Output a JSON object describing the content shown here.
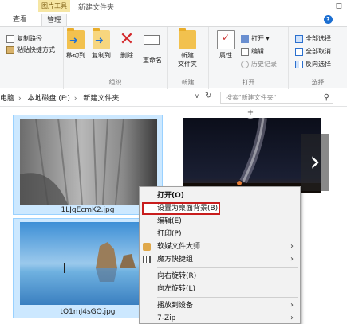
{
  "window": {
    "title": "新建文件夹",
    "context_group": "图片工具"
  },
  "tabs": {
    "view": "查看",
    "manage": "管理"
  },
  "ribbon": {
    "clipboard": {
      "copy_path": "复制路径",
      "paste_shortcut": "粘贴快捷方式"
    },
    "organize": {
      "move_to": "移动到",
      "copy_to": "复制到",
      "delete": "删除",
      "rename": "重命名",
      "label": "组织"
    },
    "new": {
      "new_folder_line1": "新建",
      "new_folder_line2": "文件夹",
      "label": "新建"
    },
    "open": {
      "properties": "属性",
      "open": "打开",
      "edit": "编辑",
      "history": "历史记录",
      "label": "打开"
    },
    "select": {
      "select_all": "全部选择",
      "select_none": "全部取消",
      "invert": "反向选择",
      "label": "选择"
    }
  },
  "address": {
    "crumbs": [
      "电脑",
      "本地磁盘 (F:)",
      "新建文件夹"
    ],
    "search_placeholder": "搜索\"新建文件夹\""
  },
  "files": [
    {
      "name": "1LJqEcmK2.jpg"
    },
    {
      "name": ""
    },
    {
      "name": "tQ1mJ4sGQ.jpg"
    }
  ],
  "context_menu": {
    "items": [
      {
        "label": "打开(O)"
      },
      {
        "label": "设置为桌面背景(B)"
      },
      {
        "label": "编辑(E)"
      },
      {
        "label": "打印(P)"
      },
      {
        "label": "软媒文件大师"
      },
      {
        "label": "魔方快捷组"
      },
      {
        "label": "向右旋转(R)"
      },
      {
        "label": "向左旋转(L)"
      },
      {
        "label": "播放到设备"
      },
      {
        "label": "7-Zip"
      }
    ]
  },
  "colors": {
    "selection": "#cce8ff",
    "highlight_border": "#c81d1d",
    "accent": "#1f6fd1"
  }
}
